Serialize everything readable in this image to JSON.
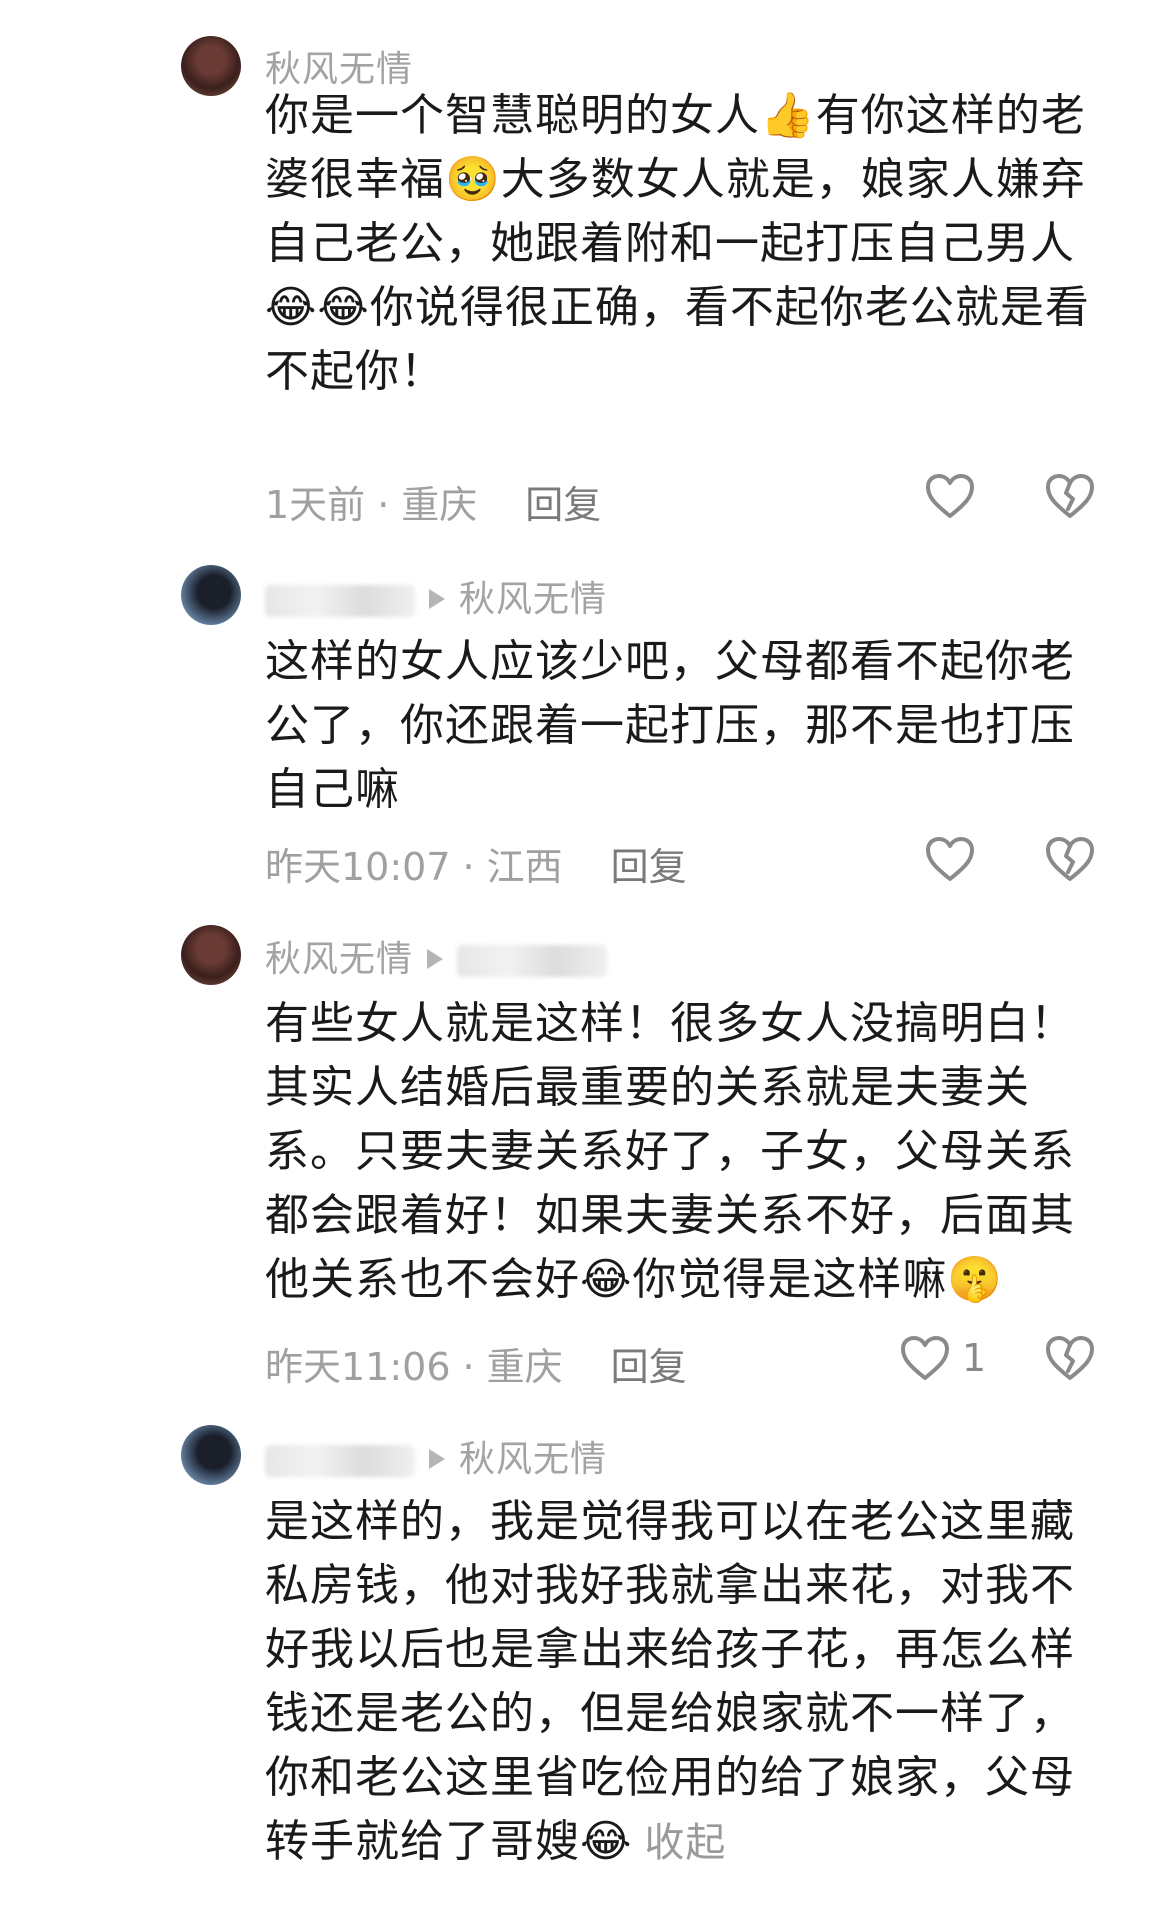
{
  "comments": [
    {
      "username": "秋风无情",
      "text_parts": [
        "你是一个智慧聪明的女人",
        "👍",
        "有你这样的老婆很幸福",
        "🥹",
        "大多数女人就是，娘家人嫌弃自己老公，她跟着附和一起打压自己男人",
        "😂😂",
        "你说得很正确，看不起你老公就是看不起你！"
      ],
      "time": "1天前",
      "location": "重庆",
      "reply": "回复"
    },
    {
      "username": "俞生语你",
      "reply_to": "秋风无情",
      "text_parts": [
        "这样的女人应该少吧，父母都看不起你老公了，你还跟着一起打压，那不是也打压自己嘛"
      ],
      "time": "昨天10:07",
      "location": "江西",
      "reply": "回复"
    },
    {
      "username": "秋风无情",
      "reply_to": "俞生语你",
      "text_parts": [
        "有些女人就是这样！很多女人没搞明白！其实人结婚后最重要的关系就是夫妻关系。只要夫妻关系好了，子女，父母关系都会跟着好！如果夫妻关系不好，后面其他关系也不会好",
        "😂",
        "你觉得是这样嘛",
        "🤫"
      ],
      "time": "昨天11:06",
      "location": "重庆",
      "reply": "回复",
      "likes": "1"
    },
    {
      "username": "俞生语你",
      "reply_to": "秋风无情",
      "text_parts": [
        "是这样的，我是觉得我可以在老公这里藏私房钱，他对我好我就拿出来花，对我不好我以后也是拿出来给孩子花，再怎么样钱还是老公的，但是给娘家就不一样了，你和老公这里省吃俭用的给了娘家，父母转手就给了哥嫂",
        "😂"
      ],
      "collapse": "收起"
    }
  ],
  "icons": {
    "like": "heart-outline-icon",
    "dislike": "broken-heart-icon",
    "reply_arrow": "triangle-right-icon"
  },
  "colors": {
    "meta": "#a0a0a0",
    "text": "#1a1a1a",
    "reply": "#7a7a7a"
  }
}
